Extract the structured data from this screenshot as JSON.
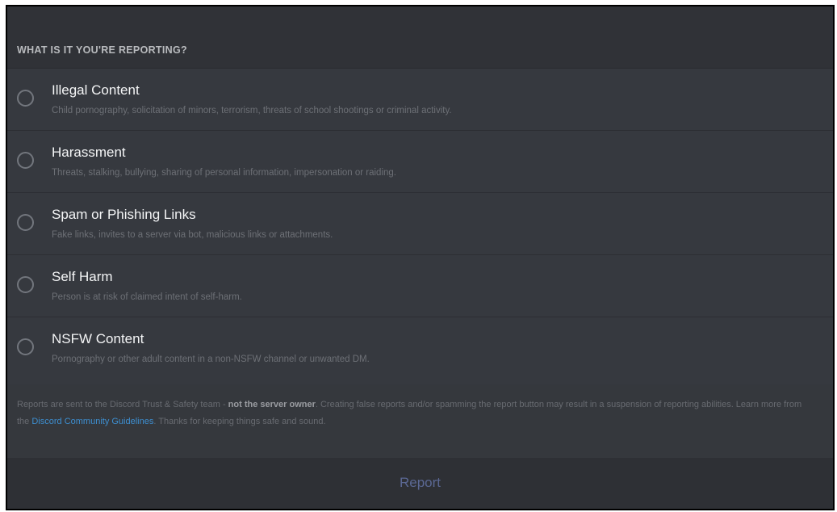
{
  "header": {
    "title": "WHAT IS IT YOU'RE REPORTING?"
  },
  "options": [
    {
      "title": "Illegal Content",
      "description": "Child pornography, solicitation of minors, terrorism, threats of school shootings or criminal activity."
    },
    {
      "title": "Harassment",
      "description": "Threats, stalking, bullying, sharing of personal information, impersonation or raiding."
    },
    {
      "title": "Spam or Phishing Links",
      "description": "Fake links, invites to a server via bot, malicious links or attachments."
    },
    {
      "title": "Self Harm",
      "description": "Person is at risk of claimed intent of self-harm."
    },
    {
      "title": "NSFW Content",
      "description": "Pornography or other adult content in a non-NSFW channel or unwanted DM."
    }
  ],
  "note": {
    "part1": "Reports are sent to the Discord Trust & Safety team - ",
    "bold": "not the server owner",
    "part2": ". Creating false reports and/or spamming the report button may result in a suspension of reporting abilities. Learn more from the ",
    "link": "Discord Community Guidelines",
    "part3": ". Thanks for keeping things safe and sound."
  },
  "actions": {
    "report_label": "Report"
  },
  "colors": {
    "background": "#36393f",
    "link": "#3d8fd1",
    "button_text": "#5b6894"
  }
}
